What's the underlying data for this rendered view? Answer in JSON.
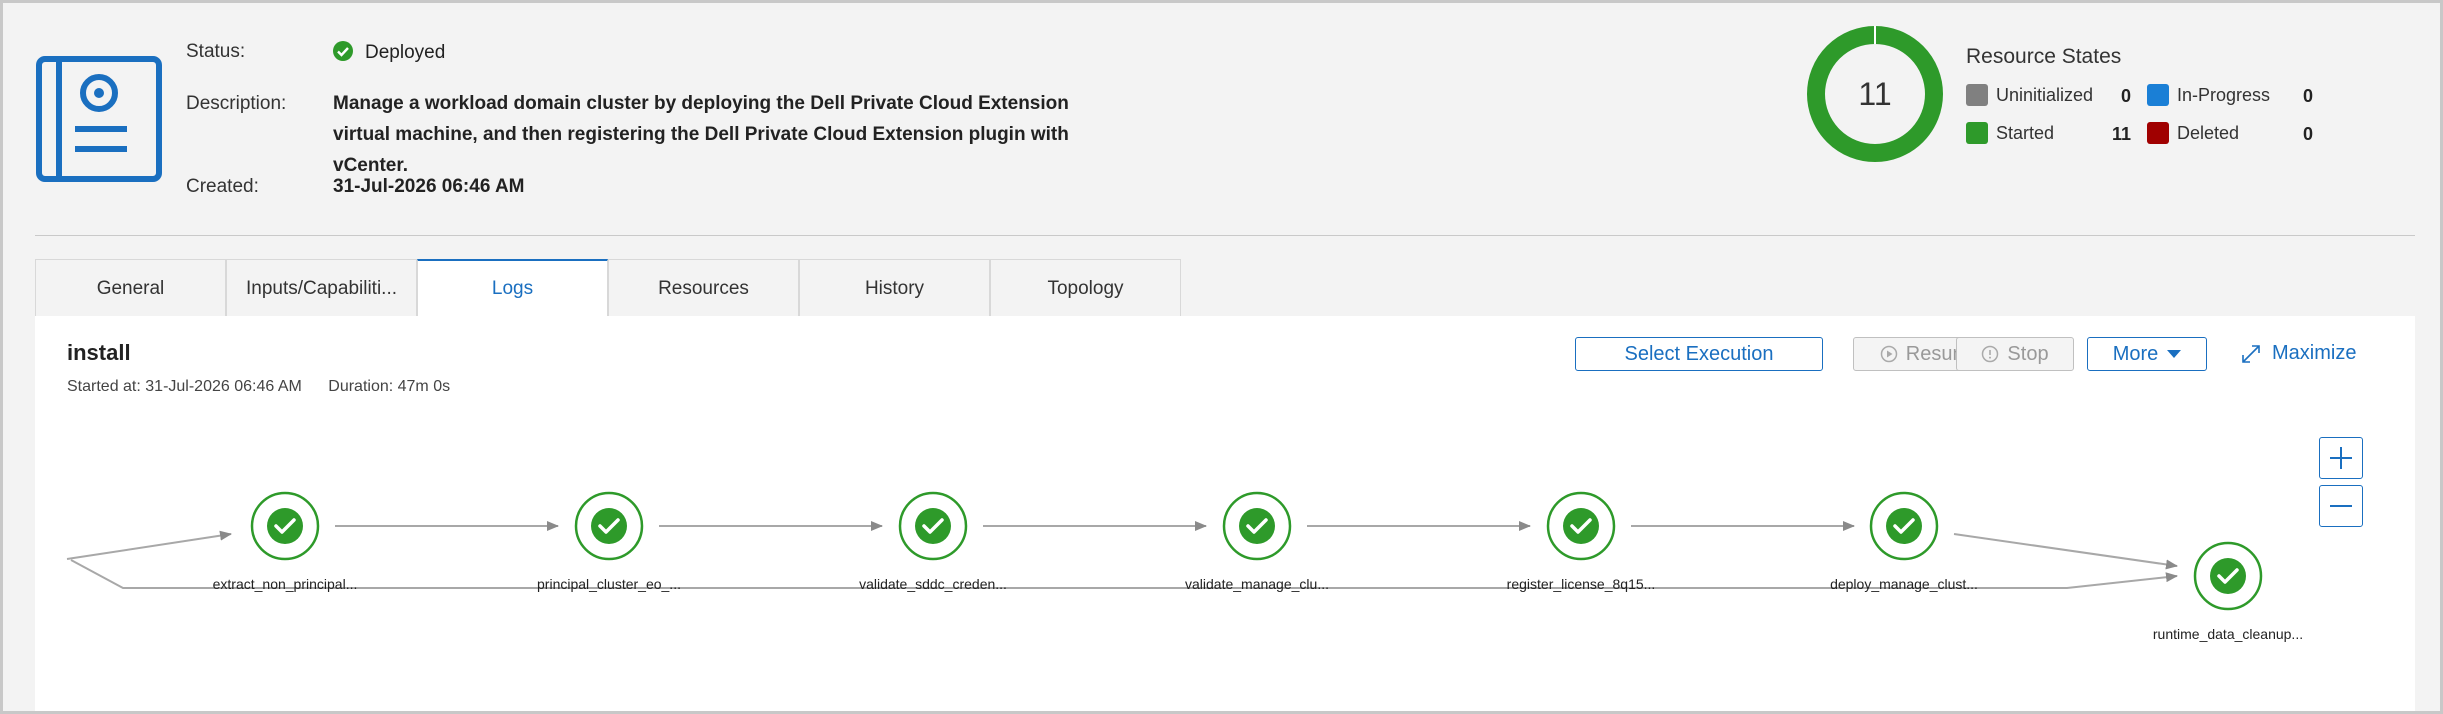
{
  "header": {
    "status_label": "Status:",
    "status_value": "Deployed",
    "description_label": "Description:",
    "description_value": "Manage a workload domain cluster by deploying the Dell Private Cloud Extension virtual machine, and then registering the Dell Private Cloud Extension plugin with vCenter.",
    "created_label": "Created:",
    "created_value": "31-Jul-2026 06:46 AM",
    "icon": "blueprint-document-icon"
  },
  "resource_states": {
    "title": "Resource States",
    "total": "11",
    "items": [
      {
        "label": "Uninitialized",
        "count": "0",
        "color": "#808080"
      },
      {
        "label": "In-Progress",
        "count": "0",
        "color": "#1a7fd6"
      },
      {
        "label": "Started",
        "count": "11",
        "color": "#2e9a2a"
      },
      {
        "label": "Deleted",
        "count": "0",
        "color": "#a00000"
      }
    ]
  },
  "tabs": [
    {
      "label": "General"
    },
    {
      "label": "Inputs/Capabiliti..."
    },
    {
      "label": "Logs",
      "active": true
    },
    {
      "label": "Resources"
    },
    {
      "label": "History"
    },
    {
      "label": "Topology"
    }
  ],
  "execution": {
    "title": "install",
    "started": "Started at: 31-Jul-2026 06:46 AM",
    "duration": "Duration: 47m 0s"
  },
  "toolbar": {
    "select_execution": "Select Execution",
    "resume": "Resume",
    "stop": "Stop",
    "more": "More",
    "maximize": "Maximize",
    "zoom_in": "+",
    "zoom_out": "−"
  },
  "workflow_nodes": [
    {
      "label": "extract_non_principal...",
      "state": "completed"
    },
    {
      "label": "principal_cluster_eo_...",
      "state": "completed"
    },
    {
      "label": "validate_sddc_creden...",
      "state": "completed"
    },
    {
      "label": "validate_manage_clu...",
      "state": "completed"
    },
    {
      "label": "register_license_8q15...",
      "state": "completed"
    },
    {
      "label": "deploy_manage_clust...",
      "state": "completed"
    },
    {
      "label": "runtime_data_cleanup...",
      "state": "completed"
    }
  ],
  "colors": {
    "accent": "#1a6fc0",
    "success": "#2e9a2a"
  }
}
